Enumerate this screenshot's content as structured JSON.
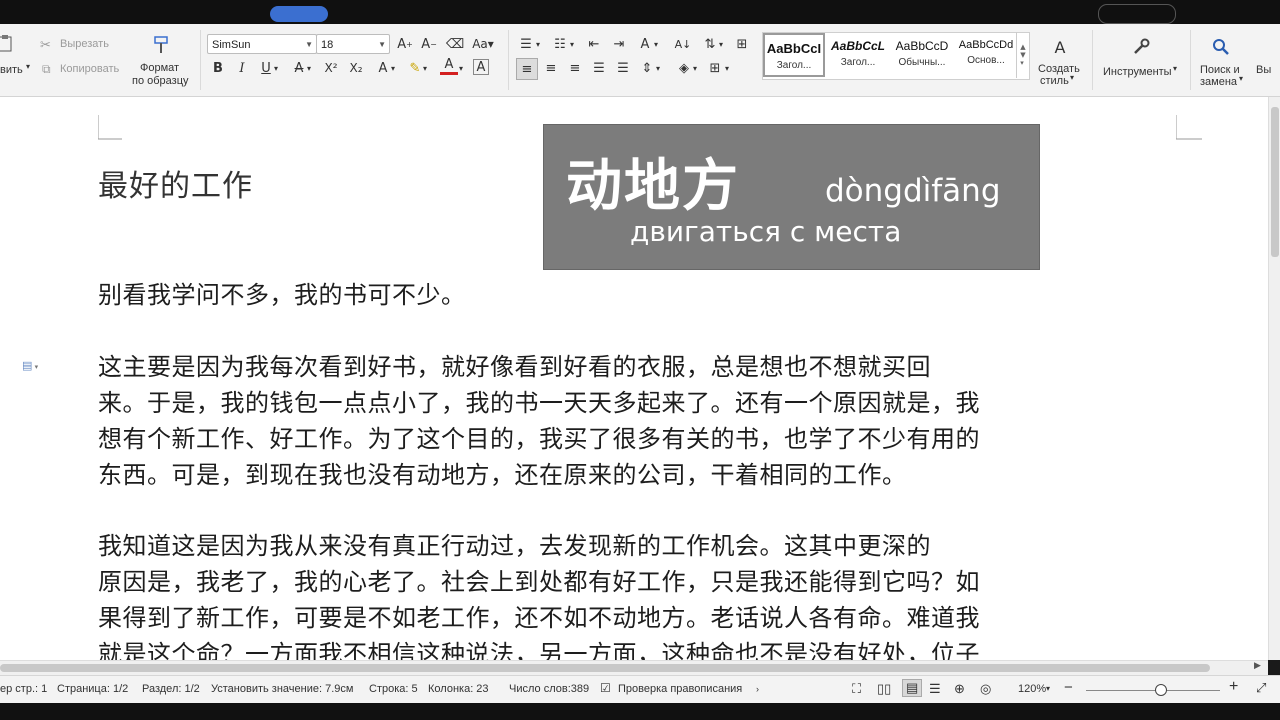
{
  "ribbon": {
    "paste_label": "вить",
    "cut_label": "Вырезать",
    "copy_label": "Копировать",
    "format_painter_label_1": "Формат",
    "format_painter_label_2": "по образцу",
    "font_name": "SimSun",
    "font_size": "18",
    "styles": [
      {
        "sample": "AaBbCcI",
        "name": "Загол..."
      },
      {
        "sample": "AaBbCcL",
        "name": "Загол..."
      },
      {
        "sample": "AaBbCcD",
        "name": "Обычны..."
      },
      {
        "sample": "AaBbCcDd",
        "name": "Основ..."
      }
    ],
    "create_style_label_1": "Создать",
    "create_style_label_2": "стиль",
    "tools_label": "Инструменты",
    "find_replace_label_1": "Поиск и",
    "find_replace_label_2": "замена",
    "more_label": "Вы"
  },
  "document": {
    "title": "最好的工作",
    "vocab": {
      "hanzi": "动地方",
      "pinyin": "dòngdìfāng",
      "translation": "двигаться с места"
    },
    "paragraphs": [
      [
        "别看我学问不多，我的书可不少。"
      ],
      [
        "这主要是因为我每次看到好书，就好像看到好看的衣服，总是想也不想就买回",
        "来。于是，我的钱包一点点小了，我的书一天天多起来了。还有一个原因就是，我",
        "想有个新工作、好工作。为了这个目的，我买了很多有关的书，也学了不少有用的",
        "东西。可是，到现在我也没有动地方，还在原来的公司，干着相同的工作。"
      ],
      [
        "我知道这是因为我从来没有真正行动过，去发现新的工作机会。这其中更深的",
        "原因是，我老了，我的心老了。社会上到处都有好工作，只是我还能得到它吗？如",
        "果得到了新工作，可要是不如老工作，还不如不动地方。老话说人各有命。难道我",
        "就是这个命？一方面我不相信这种说法，另一方面，这种命也不是没有好处，位子"
      ]
    ]
  },
  "status": {
    "pages_of_section": "ер стр.: 1",
    "page": "Страница: 1/2",
    "section": "Раздел: 1/2",
    "set_value": "Установить значение: 7.9см",
    "line": "Строка: 5",
    "column": "Колонка: 23",
    "word_count": "Число слов:389",
    "spellcheck": "Проверка правописания",
    "zoom": "120%",
    "zoom_level": 0.55
  },
  "colors": {
    "ribbon_bg": "#f3f3f3",
    "vocab_box": "#7c7c7c",
    "accent": "#3b6fd0"
  }
}
